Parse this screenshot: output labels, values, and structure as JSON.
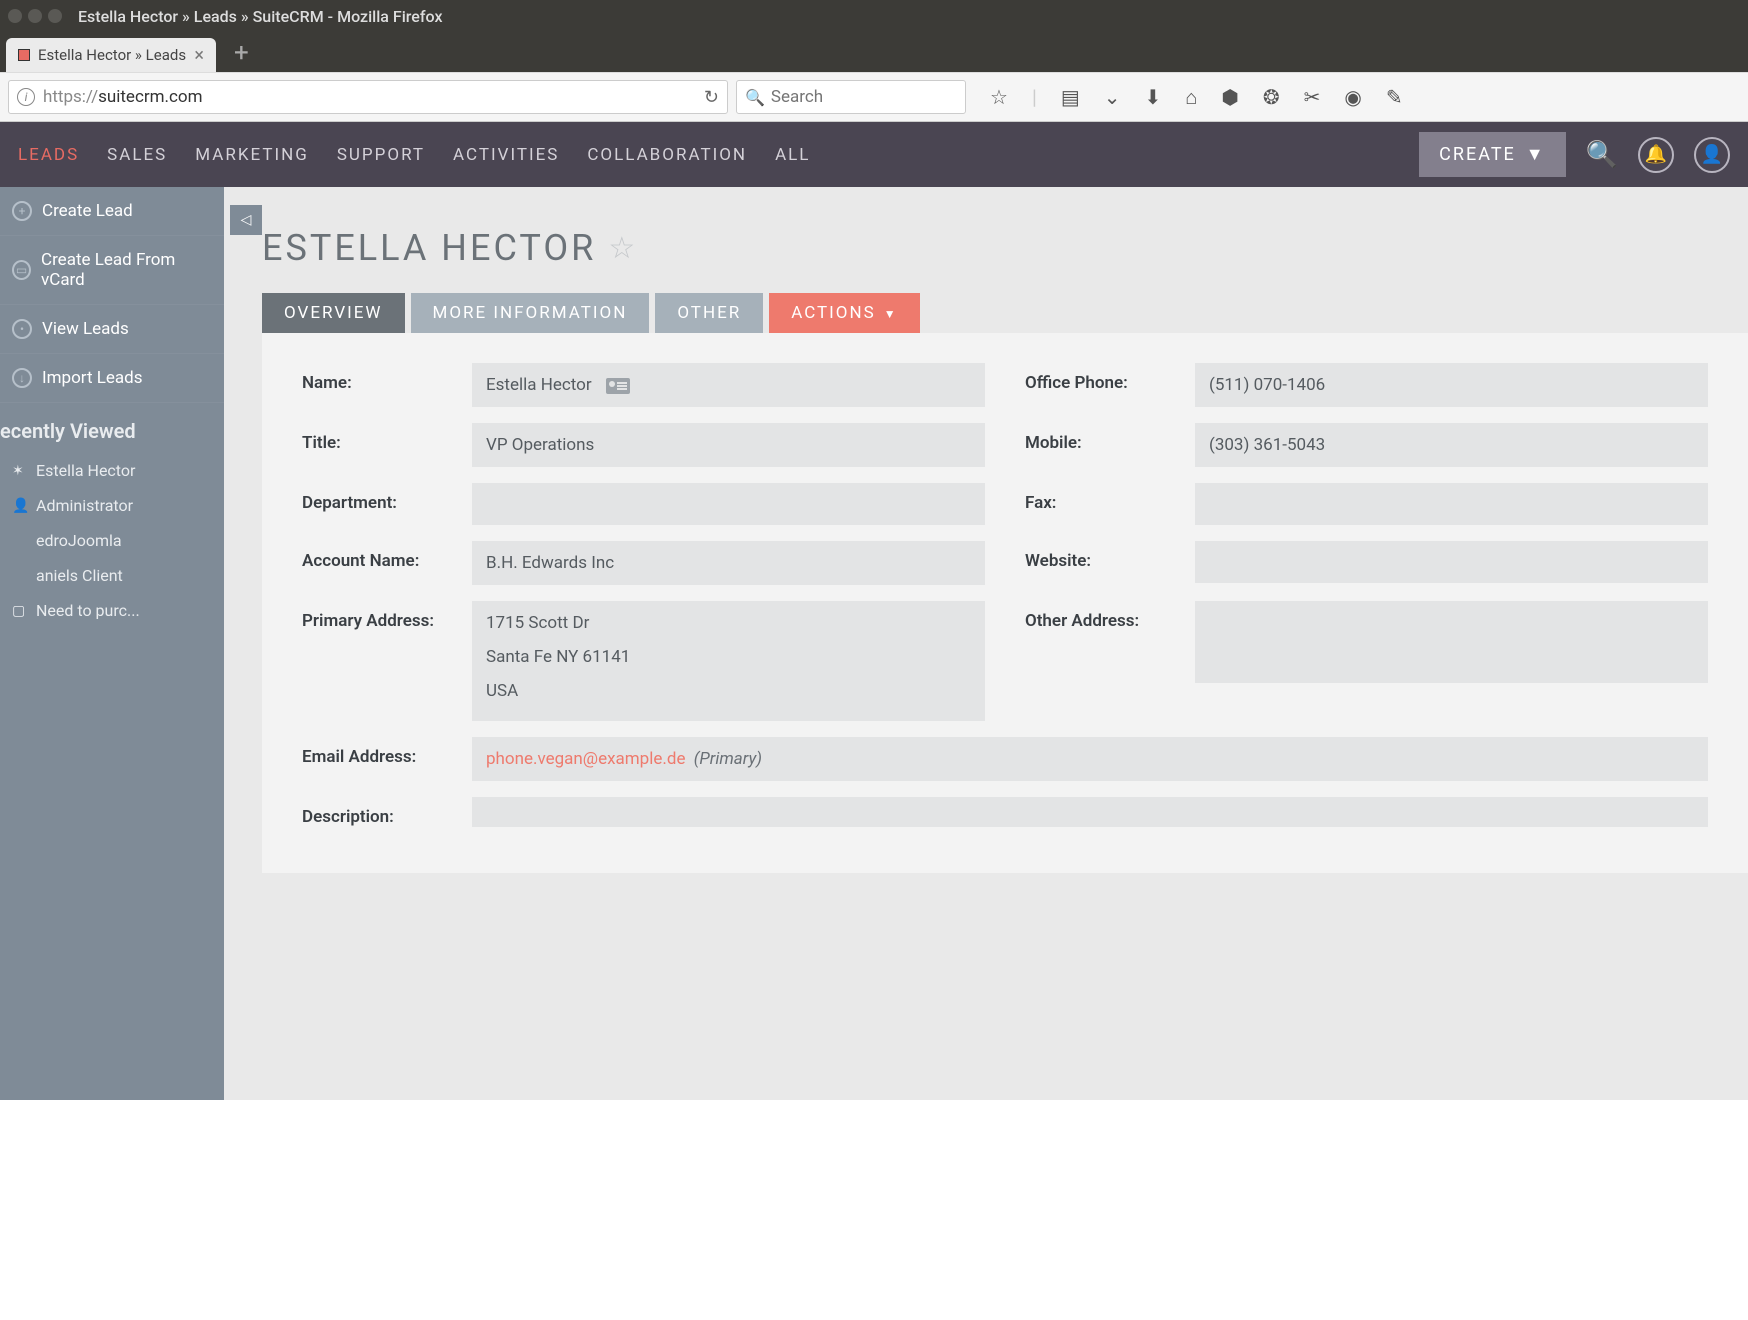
{
  "os": {
    "title": "Estella Hector » Leads » SuiteCRM - Mozilla Firefox"
  },
  "browser": {
    "tab_title": "Estella Hector » Leads",
    "url_prefix": "https://",
    "url_host": "suitecrm.com",
    "search_placeholder": "Search"
  },
  "topnav": {
    "items": [
      "LEADS",
      "SALES",
      "MARKETING",
      "SUPPORT",
      "ACTIVITIES",
      "COLLABORATION",
      "ALL"
    ],
    "create_label": "CREATE"
  },
  "sidebar": {
    "actions": [
      {
        "label": "Create Lead",
        "icon": "+"
      },
      {
        "label": "Create Lead From vCard",
        "icon": "▭"
      },
      {
        "label": "View Leads",
        "icon": "•"
      },
      {
        "label": "Import Leads",
        "icon": "↓"
      }
    ],
    "recent_title": "ecently Viewed",
    "recent": [
      {
        "label": "Estella Hector",
        "icon": "✶"
      },
      {
        "label": "Administrator",
        "icon": "👤"
      },
      {
        "label": "edroJoomla",
        "icon": ""
      },
      {
        "label": "aniels Client",
        "icon": ""
      },
      {
        "label": "Need to purc...",
        "icon": "▢"
      }
    ]
  },
  "page": {
    "title": "ESTELLA HECTOR",
    "tabs": {
      "overview": "OVERVIEW",
      "more": "MORE INFORMATION",
      "other": "OTHER",
      "actions": "ACTIONS"
    },
    "fields": {
      "name_label": "Name:",
      "name_value": "Estella Hector",
      "title_label": "Title:",
      "title_value": "VP Operations",
      "department_label": "Department:",
      "department_value": "",
      "account_label": "Account Name:",
      "account_value": "B.H. Edwards Inc",
      "primary_addr_label": "Primary Address:",
      "primary_addr_line1": "1715 Scott Dr",
      "primary_addr_line2": "Santa Fe NY   61141",
      "primary_addr_line3": "USA",
      "office_label": "Office Phone:",
      "office_value": "(511) 070-1406",
      "mobile_label": "Mobile:",
      "mobile_value": "(303) 361-5043",
      "fax_label": "Fax:",
      "fax_value": "",
      "website_label": "Website:",
      "website_value": "",
      "other_addr_label": "Other Address:",
      "other_addr_value": "",
      "email_label": "Email Address:",
      "email_value": "phone.vegan@example.de",
      "email_primary": "(Primary)",
      "description_label": "Description:",
      "description_value": ""
    }
  }
}
